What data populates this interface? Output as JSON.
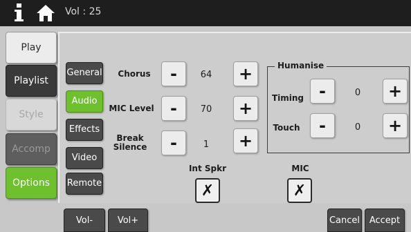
{
  "header": {
    "volume_text": "Vol : 25",
    "info_icon": "info-icon",
    "home_icon": "home-icon"
  },
  "nav": {
    "play": "Play",
    "playlist": "Playlist",
    "style": "Style",
    "accomp": "Accomp",
    "options": "Options"
  },
  "subnav": {
    "general": "General",
    "audio": "Audio",
    "effects": "Effects",
    "video": "Video",
    "remote": "Remote"
  },
  "audio": {
    "chorus": {
      "label": "Chorus",
      "value": "64"
    },
    "mic_level": {
      "label": "MIC Level",
      "value": "70"
    },
    "break_silence": {
      "label": "Break Silence",
      "value": "1"
    },
    "minus": "-",
    "plus": "+"
  },
  "humanise": {
    "title": "Humanise",
    "timing": {
      "label": "Timing",
      "value": "0"
    },
    "touch": {
      "label": "Touch",
      "value": "0"
    }
  },
  "toggles": {
    "int_spkr": {
      "label": "Int Spkr",
      "mark": "✗"
    },
    "mic": {
      "label": "MIC",
      "mark": "✗"
    }
  },
  "bottom": {
    "vol_minus": "Vol-",
    "vol_plus": "Vol+",
    "cancel": "Cancel",
    "accept": "Accept"
  },
  "colors": {
    "accent_green": "#6ec02f",
    "dark": "#1e1e1e"
  }
}
